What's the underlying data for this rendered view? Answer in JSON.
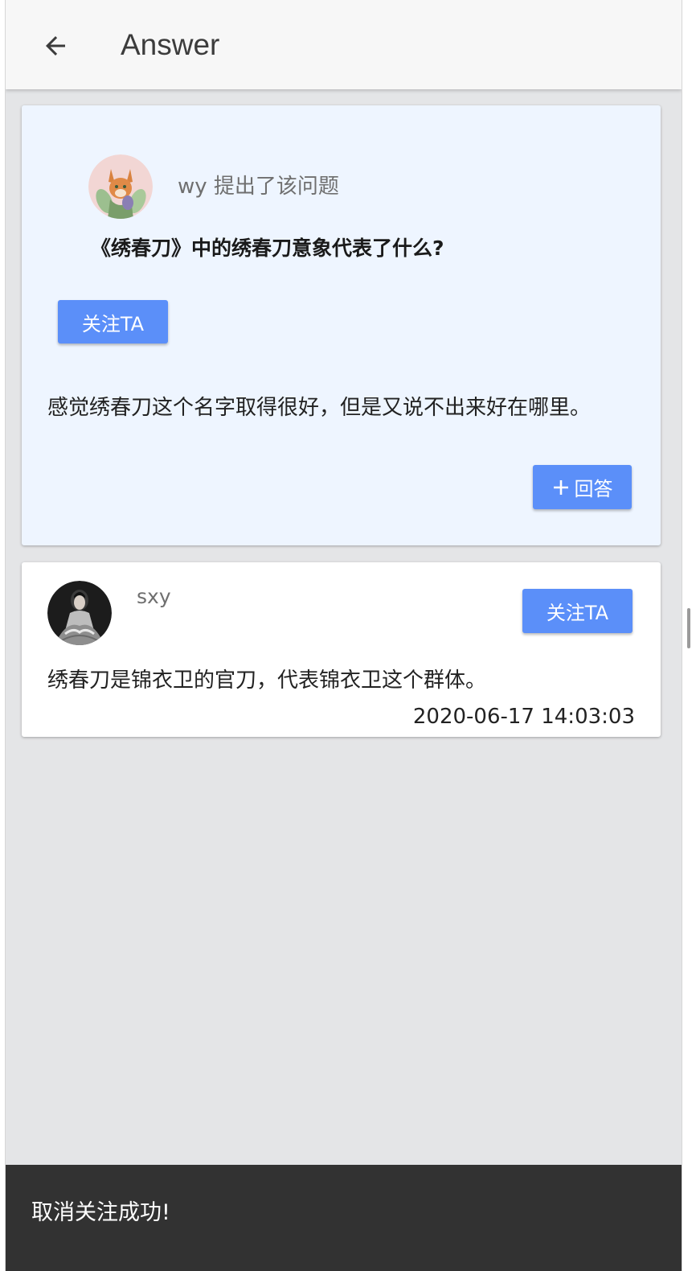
{
  "app_bar": {
    "title": "Answer",
    "back_icon": "arrow-left-icon"
  },
  "question": {
    "asker_line": "wy 提出了该问题",
    "title": "《绣春刀》中的绣春刀意象代表了什么?",
    "follow_label": "关注TA",
    "description": "感觉绣春刀这个名字取得很好，但是又说不出来好在哪里。",
    "answer_label": "回答",
    "answer_icon": "plus-icon",
    "background": "#eef5ff"
  },
  "answers": [
    {
      "author": "sxy",
      "follow_label": "关注TA",
      "content": "绣春刀是锦衣卫的官刀，代表锦衣卫这个群体。",
      "time": "2020-06-17 14:03:03"
    }
  ],
  "snackbar": {
    "message": "取消关注成功!"
  },
  "colors": {
    "accent": "#5b8ff9",
    "page_background": "#e4e5e7",
    "snackbar": "#323232"
  }
}
